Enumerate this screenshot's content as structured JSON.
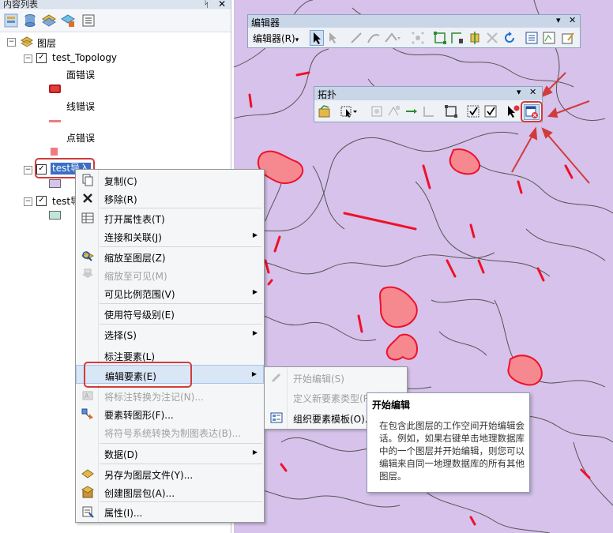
{
  "toc": {
    "title": "内容列表",
    "pin": "ᛋ",
    "close": "✕",
    "toolbar_icons": [
      "list-by-drawing-order-icon",
      "list-by-source-icon",
      "list-by-visibility-icon",
      "list-by-selection-icon",
      "options-icon"
    ],
    "root_label": "图层",
    "layers": [
      {
        "name": "test_Topology",
        "checked": true,
        "legend": [
          "面错误",
          "线错误",
          "点错误"
        ]
      },
      {
        "name": "test导入",
        "checked": true,
        "selected": true
      },
      {
        "name": "test导",
        "checked": true
      }
    ]
  },
  "editor_toolbar": {
    "title": "编辑器",
    "menu_label": "编辑器(R)",
    "menu_arrow": "▾",
    "dropdown_btn": "▾",
    "close_btn": "✕"
  },
  "topology_toolbar": {
    "title": "拓扑",
    "dropdown_btn": "▾",
    "close_btn": "✕"
  },
  "context_menu": {
    "items": [
      {
        "label": "复制(C)",
        "icon": "copy-icon",
        "enabled": true
      },
      {
        "label": "移除(R)",
        "icon": "remove-icon",
        "enabled": true
      },
      {
        "label": "打开属性表(T)",
        "icon": "table-icon",
        "enabled": true
      },
      {
        "label": "连接和关联(J)",
        "icon": "",
        "enabled": true,
        "submenu": true
      },
      {
        "label": "缩放至图层(Z)",
        "icon": "zoom-to-layer-icon",
        "enabled": true
      },
      {
        "label": "缩放至可见(M)",
        "icon": "zoom-to-visible-icon",
        "enabled": false
      },
      {
        "label": "可见比例范围(V)",
        "icon": "",
        "enabled": true,
        "submenu": true
      },
      {
        "label": "使用符号级别(E)",
        "icon": "",
        "enabled": true
      },
      {
        "label": "选择(S)",
        "icon": "",
        "enabled": true,
        "submenu": true
      },
      {
        "label": "标注要素(L)",
        "icon": "",
        "enabled": true
      },
      {
        "label": "编辑要素(E)",
        "icon": "",
        "enabled": true,
        "submenu": true,
        "highlighted": true
      },
      {
        "label": "将标注转换为注记(N)...",
        "icon": "convert-labels-icon",
        "enabled": false
      },
      {
        "label": "要素转图形(F)...",
        "icon": "features-to-graphics-icon",
        "enabled": true
      },
      {
        "label": "将符号系统转换为制图表达(B)...",
        "icon": "",
        "enabled": false
      },
      {
        "label": "数据(D)",
        "icon": "",
        "enabled": true,
        "submenu": true
      },
      {
        "label": "另存为图层文件(Y)...",
        "icon": "layer-file-icon",
        "enabled": true
      },
      {
        "label": "创建图层包(A)...",
        "icon": "layer-package-icon",
        "enabled": true
      },
      {
        "label": "属性(I)...",
        "icon": "properties-icon",
        "enabled": true
      }
    ],
    "submenu_arrow": "▶"
  },
  "edit_submenu": {
    "items": [
      {
        "label": "开始编辑(S)",
        "icon": "start-editing-icon",
        "enabled": false
      },
      {
        "label": "定义新要素类型(R)...",
        "icon": "",
        "enabled": false
      },
      {
        "label": "组织要素模板(O)...",
        "icon": "organize-templates-icon",
        "enabled": true
      }
    ]
  },
  "tooltip": {
    "title": "开始编辑",
    "body": "在包含此图层的工作空间开始编辑会话。例如，如果右键单击地理数据库中的一个图层并开始编辑，则您可以编辑来自同一地理数据库的所有其他图层。"
  },
  "colors": {
    "map_fill": "#d6c2ea",
    "error_red": "#f0102a",
    "annotation_red": "#d23b3b",
    "legend_line": "#f07a80",
    "legend_fill": "#e53b3b",
    "highlight": "#d9e6f6"
  }
}
